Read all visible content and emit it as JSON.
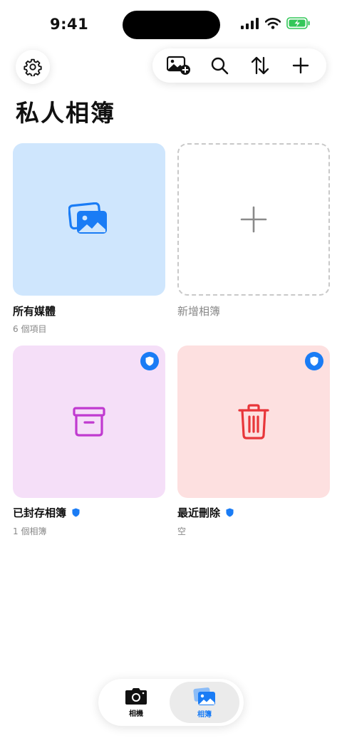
{
  "status_bar": {
    "time": "9:41"
  },
  "toolbar": {
    "settings_icon": "gear-icon",
    "add_photo_icon": "add-photo-icon",
    "search_icon": "search-icon",
    "sort_icon": "sort-arrows-icon",
    "add_icon": "plus-icon"
  },
  "page": {
    "title": "私人相簿"
  },
  "albums": [
    {
      "name": "所有媒體",
      "count": "6 個項目",
      "icon": "photos-stack-icon",
      "color": "#cfe6fd"
    },
    {
      "name": "新增相簿",
      "icon": "plus-icon"
    },
    {
      "name": "已封存相簿",
      "count": "1 個相簿",
      "icon": "archive-box-icon",
      "color": "#f5dff8",
      "protected": true
    },
    {
      "name": "最近刪除",
      "count": "空",
      "icon": "trash-icon",
      "color": "#fde0e0",
      "protected": true
    }
  ],
  "tab_bar": {
    "tabs": [
      {
        "label": "相機",
        "icon": "camera-icon"
      },
      {
        "label": "相簿",
        "icon": "photos-icon",
        "selected": true
      }
    ]
  },
  "colors": {
    "accent": "#1a7cf5",
    "archive": "#c03ad0",
    "trash": "#e8363a"
  }
}
